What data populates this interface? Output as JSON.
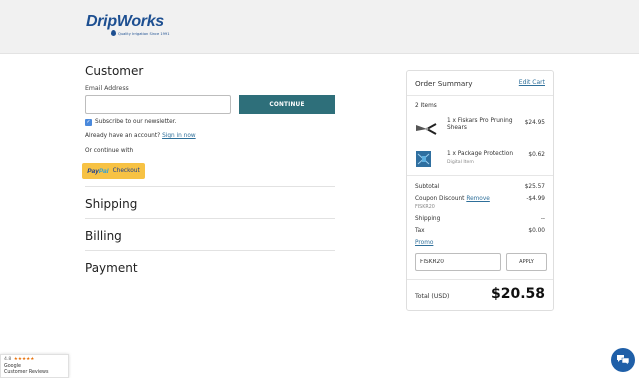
{
  "header": {
    "logo_text": "DripWorks",
    "logo_tagline": "Quality Irrigation Since 1991"
  },
  "customer": {
    "title": "Customer",
    "email_label": "Email Address",
    "email_value": "",
    "continue_label": "CONTINUE",
    "subscribe_label": "Subscribe to our newsletter.",
    "subscribe_checked": true,
    "have_account": "Already have an account?",
    "signin_label": "Sign in now",
    "or_continue": "Or continue with",
    "paypal": {
      "word1": "Pay",
      "word2": "Pal",
      "suffix": "Checkout"
    }
  },
  "sections": {
    "shipping": "Shipping",
    "billing": "Billing",
    "payment": "Payment"
  },
  "summary": {
    "title": "Order Summary",
    "edit_cart": "Edit Cart",
    "items_count": "2 Items",
    "items": [
      {
        "name": "1 x Fiskars Pro Pruning Shears",
        "sub": "",
        "price": "$24.95",
        "icon": "pruning-shears-image"
      },
      {
        "name": "1 x Package Protection",
        "sub": "Digital Item",
        "price": "$0.62",
        "icon": "package-protection-image"
      }
    ],
    "subtotal_label": "Subtotal",
    "subtotal_value": "$25.57",
    "coupon_label": "Coupon Discount",
    "coupon_remove": "Remove",
    "coupon_value": "-$4.99",
    "coupon_code": "FISKR20",
    "shipping_label": "Shipping",
    "shipping_value": "--",
    "tax_label": "Tax",
    "tax_value": "$0.00",
    "promo_label": "Promo",
    "promo_value": "FISKR20",
    "apply_label": "APPLY",
    "total_label": "Total (USD)",
    "total_value": "$20.58"
  },
  "reviews_badge": {
    "rating": "4.8",
    "stars": "★★★★★",
    "line1": "Google",
    "line2": "Customer Reviews"
  },
  "colors": {
    "accent": "#2e6f7a",
    "link": "#2e6f9a",
    "paypal": "#f7c244",
    "chat": "#1f5fa8"
  }
}
